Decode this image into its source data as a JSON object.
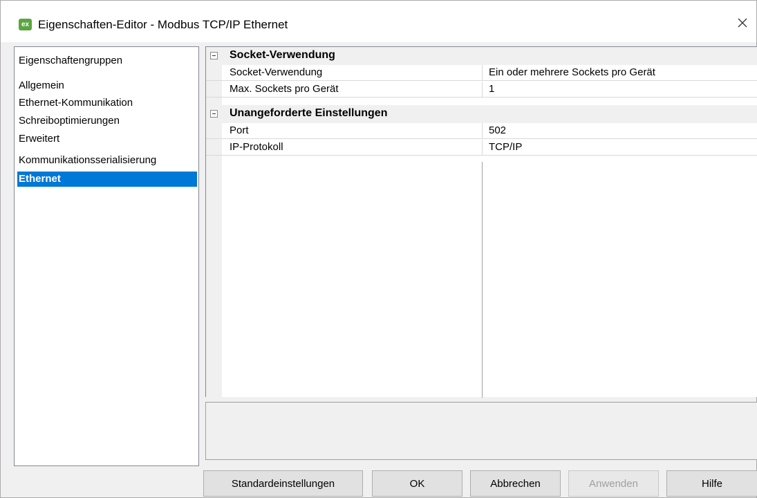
{
  "window": {
    "app_icon_text": "ex",
    "title": "Eigenschaften-Editor - Modbus TCP/IP Ethernet"
  },
  "groups": {
    "header": "Eigenschaftengruppen",
    "items": [
      {
        "label": "Allgemein"
      },
      {
        "label": "Ethernet-Kommunikation"
      },
      {
        "label": "Schreiboptimierungen"
      },
      {
        "label": "Erweitert"
      },
      {
        "label": "Kommunikationsserialisierung"
      },
      {
        "label": "Ethernet",
        "selected": true
      }
    ]
  },
  "grid": {
    "categories": [
      {
        "label": "Socket-Verwendung",
        "properties": [
          {
            "name": "Socket-Verwendung",
            "value": "Ein oder mehrere Sockets pro Gerät"
          },
          {
            "name": "Max. Sockets pro Gerät",
            "value": "1"
          }
        ]
      },
      {
        "label": "Unangeforderte Einstellungen",
        "properties": [
          {
            "name": "Port",
            "value": "502"
          },
          {
            "name": "IP-Protokoll",
            "value": "TCP/IP"
          }
        ]
      }
    ]
  },
  "buttons": {
    "defaults": "Standardeinstellungen",
    "ok": "OK",
    "cancel": "Abbrechen",
    "apply": "Anwenden",
    "help": "Hilfe"
  },
  "colors": {
    "selection": "#0078d7",
    "app_icon": "#5aa53f"
  }
}
